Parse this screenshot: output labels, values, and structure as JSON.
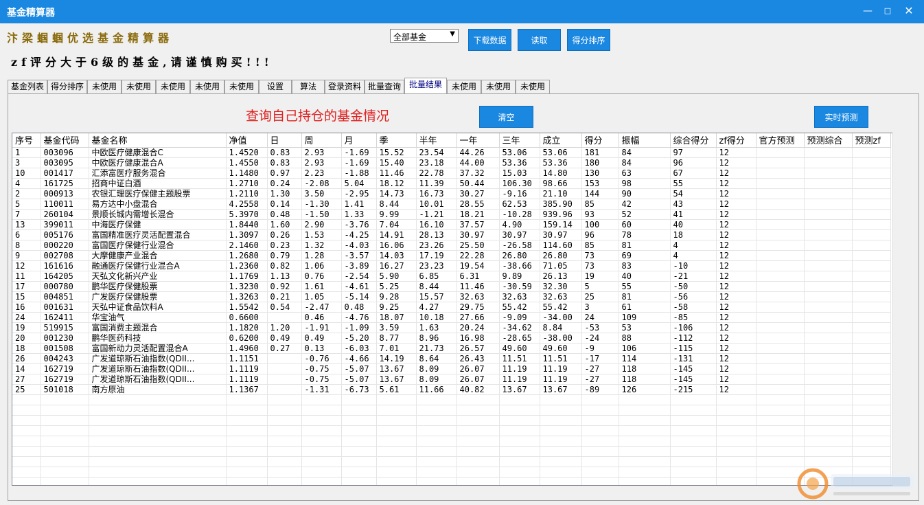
{
  "window": {
    "title": "基金精算器"
  },
  "header": {
    "brand": "汴梁蝈蝈优选基金精算器",
    "warning": "zf评分大于6级的基金,请谨慎购买!!!",
    "fund_select": "全部基金",
    "download_label": "下载数据",
    "read_label": "读取",
    "sort_label": "得分排序"
  },
  "tabs": [
    {
      "label": "基金列表",
      "active": false
    },
    {
      "label": "得分排序",
      "active": false
    },
    {
      "label": "未使用",
      "active": false
    },
    {
      "label": "未使用",
      "active": false
    },
    {
      "label": "未使用",
      "active": false
    },
    {
      "label": "未使用",
      "active": false
    },
    {
      "label": "未使用",
      "active": false
    },
    {
      "label": "设置",
      "active": false
    },
    {
      "label": "算法",
      "active": false
    },
    {
      "label": "登录资料",
      "active": false
    },
    {
      "label": "批量查询",
      "active": false
    },
    {
      "label": "批量结果",
      "active": true
    },
    {
      "label": "未使用",
      "active": false
    },
    {
      "label": "未使用",
      "active": false
    },
    {
      "label": "未使用",
      "active": false
    }
  ],
  "panel": {
    "heading": "查询自己持仓的基金情况",
    "clear_label": "清空",
    "predict_label": "实时预测"
  },
  "table": {
    "columns": [
      "序号",
      "基金代码",
      "基金名称",
      "净值",
      "日",
      "周",
      "月",
      "季",
      "半年",
      "一年",
      "三年",
      "成立",
      "得分",
      "振幅",
      "综合得分",
      "zf得分",
      "官方预测",
      "预测综合",
      "预测zf"
    ],
    "rows": [
      [
        "1",
        "003096",
        "中欧医疗健康混合C",
        "1.4520",
        "0.83",
        "2.93",
        "-1.69",
        "15.52",
        "23.54",
        "44.26",
        "53.06",
        "53.06",
        "181",
        "84",
        "97",
        "12",
        "",
        "",
        ""
      ],
      [
        "3",
        "003095",
        "中欧医疗健康混合A",
        "1.4550",
        "0.83",
        "2.93",
        "-1.69",
        "15.40",
        "23.18",
        "44.00",
        "53.36",
        "53.36",
        "180",
        "84",
        "96",
        "12",
        "",
        "",
        ""
      ],
      [
        "10",
        "001417",
        "汇添富医疗服务混合",
        "1.1480",
        "0.97",
        "2.23",
        "-1.88",
        "11.46",
        "22.78",
        "37.32",
        "15.03",
        "14.80",
        "130",
        "63",
        "67",
        "12",
        "",
        "",
        ""
      ],
      [
        "4",
        "161725",
        "招商中证白酒",
        "1.2710",
        "0.24",
        "-2.08",
        "5.04",
        "18.12",
        "11.39",
        "50.44",
        "106.30",
        "98.66",
        "153",
        "98",
        "55",
        "12",
        "",
        "",
        ""
      ],
      [
        "2",
        "000913",
        "农银汇理医疗保健主题股票",
        "1.2110",
        "1.30",
        "3.50",
        "-2.95",
        "14.73",
        "16.73",
        "30.27",
        "-9.16",
        "21.10",
        "144",
        "90",
        "54",
        "12",
        "",
        "",
        ""
      ],
      [
        "5",
        "110011",
        "易方达中小盘混合",
        "4.2558",
        "0.14",
        "-1.30",
        "1.41",
        "8.44",
        "10.01",
        "28.55",
        "62.53",
        "385.90",
        "85",
        "42",
        "43",
        "12",
        "",
        "",
        ""
      ],
      [
        "7",
        "260104",
        "景顺长城内需增长混合",
        "5.3970",
        "0.48",
        "-1.50",
        "1.33",
        "9.99",
        "-1.21",
        "18.21",
        "-10.28",
        "939.96",
        "93",
        "52",
        "41",
        "12",
        "",
        "",
        ""
      ],
      [
        "13",
        "399011",
        "中海医疗保健",
        "1.8440",
        "1.60",
        "2.90",
        "-3.76",
        "7.04",
        "16.10",
        "37.57",
        "4.90",
        "159.14",
        "100",
        "60",
        "40",
        "12",
        "",
        "",
        ""
      ],
      [
        "6",
        "005176",
        "富国精准医疗灵活配置混合",
        "1.3097",
        "0.26",
        "1.53",
        "-4.25",
        "14.91",
        "28.13",
        "30.97",
        "30.97",
        "30.97",
        "96",
        "78",
        "18",
        "12",
        "",
        "",
        ""
      ],
      [
        "8",
        "000220",
        "富国医疗保健行业混合",
        "2.1460",
        "0.23",
        "1.32",
        "-4.03",
        "16.06",
        "23.26",
        "25.50",
        "-26.58",
        "114.60",
        "85",
        "81",
        "4",
        "12",
        "",
        "",
        ""
      ],
      [
        "9",
        "002708",
        "大摩健康产业混合",
        "1.2680",
        "0.79",
        "1.28",
        "-3.57",
        "14.03",
        "17.19",
        "22.28",
        "26.80",
        "26.80",
        "73",
        "69",
        "4",
        "12",
        "",
        "",
        ""
      ],
      [
        "12",
        "161616",
        "融通医疗保健行业混合A",
        "1.2360",
        "0.82",
        "1.06",
        "-3.89",
        "16.27",
        "23.23",
        "19.54",
        "-38.66",
        "71.05",
        "73",
        "83",
        "-10",
        "12",
        "",
        "",
        ""
      ],
      [
        "11",
        "164205",
        "天弘文化新兴产业",
        "1.1769",
        "1.13",
        "0.76",
        "-2.54",
        "5.90",
        "6.85",
        "6.31",
        "9.89",
        "26.13",
        "19",
        "40",
        "-21",
        "12",
        "",
        "",
        ""
      ],
      [
        "17",
        "000780",
        "鹏华医疗保健股票",
        "1.3230",
        "0.92",
        "1.61",
        "-4.61",
        "5.25",
        "8.44",
        "11.46",
        "-30.59",
        "32.30",
        "5",
        "55",
        "-50",
        "12",
        "",
        "",
        ""
      ],
      [
        "15",
        "004851",
        "广发医疗保健股票",
        "1.3263",
        "0.21",
        "1.05",
        "-5.14",
        "9.28",
        "15.57",
        "32.63",
        "32.63",
        "32.63",
        "25",
        "81",
        "-56",
        "12",
        "",
        "",
        ""
      ],
      [
        "16",
        "001631",
        "天弘中证食品饮料A",
        "1.5542",
        "0.54",
        "-2.47",
        "0.48",
        "9.25",
        "4.27",
        "29.75",
        "55.42",
        "55.42",
        "3",
        "61",
        "-58",
        "12",
        "",
        "",
        ""
      ],
      [
        "24",
        "162411",
        "华宝油气",
        "0.6600",
        "",
        "0.46",
        "-4.76",
        "18.07",
        "10.18",
        "27.66",
        "-9.09",
        "-34.00",
        "24",
        "109",
        "-85",
        "12",
        "",
        "",
        ""
      ],
      [
        "19",
        "519915",
        "富国消费主题混合",
        "1.1820",
        "1.20",
        "-1.91",
        "-1.09",
        "3.59",
        "1.63",
        "20.24",
        "-34.62",
        "8.84",
        "-53",
        "53",
        "-106",
        "12",
        "",
        "",
        ""
      ],
      [
        "20",
        "001230",
        "鹏华医药科技",
        "0.6200",
        "0.49",
        "0.49",
        "-5.20",
        "8.77",
        "8.96",
        "16.98",
        "-28.65",
        "-38.00",
        "-24",
        "88",
        "-112",
        "12",
        "",
        "",
        ""
      ],
      [
        "18",
        "001508",
        "富国新动力灵活配置混合A",
        "1.4960",
        "0.27",
        "0.13",
        "-6.03",
        "7.01",
        "21.73",
        "26.57",
        "49.60",
        "49.60",
        "-9",
        "106",
        "-115",
        "12",
        "",
        "",
        ""
      ],
      [
        "26",
        "004243",
        "广发道琼斯石油指数(QDII...",
        "1.1151",
        "",
        "-0.76",
        "-4.66",
        "14.19",
        "8.64",
        "26.43",
        "11.51",
        "11.51",
        "-17",
        "114",
        "-131",
        "12",
        "",
        "",
        ""
      ],
      [
        "14",
        "162719",
        "广发道琼斯石油指数(QDII...",
        "1.1119",
        "",
        "-0.75",
        "-5.07",
        "13.67",
        "8.09",
        "26.07",
        "11.19",
        "11.19",
        "-27",
        "118",
        "-145",
        "12",
        "",
        "",
        ""
      ],
      [
        "27",
        "162719",
        "广发道琼斯石油指数(QDII...",
        "1.1119",
        "",
        "-0.75",
        "-5.07",
        "13.67",
        "8.09",
        "26.07",
        "11.19",
        "11.19",
        "-27",
        "118",
        "-145",
        "12",
        "",
        "",
        ""
      ],
      [
        "25",
        "501018",
        "南方原油",
        "1.1367",
        "",
        "-1.31",
        "-6.73",
        "5.61",
        "11.66",
        "40.82",
        "13.67",
        "13.67",
        "-89",
        "126",
        "-215",
        "12",
        "",
        "",
        ""
      ]
    ]
  },
  "colors": {
    "titlebar": "#1a87e0",
    "brand": "#8a6a0a",
    "heading": "#e02020"
  }
}
